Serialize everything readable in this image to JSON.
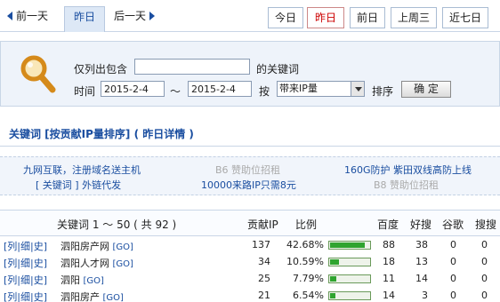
{
  "nav": {
    "prev_label": "前一天",
    "current_label": "昨日",
    "next_label": "后一天",
    "tabs": [
      {
        "label": "今日",
        "active": false
      },
      {
        "label": "昨日",
        "active": true
      },
      {
        "label": "前日",
        "active": false
      },
      {
        "label": "上周三",
        "active": false
      },
      {
        "label": "近七日",
        "active": false
      }
    ]
  },
  "filter": {
    "only_list_label": "仅列出包含",
    "keyword_value": "",
    "keyword_suffix": "的关键词",
    "time_label": "时间",
    "date_from": "2015-2-4",
    "range_sep": "～",
    "date_to": "2015-2-4",
    "by_label": "按",
    "sort_select": "带来IP量",
    "sort_label": "排序",
    "confirm_button": "确 定"
  },
  "section_title": "关键词 [按贡献IP量排序] ( 昨日详情 )",
  "ads": [
    {
      "text": "九网互联，注册域名送主机"
    },
    {
      "text": "B6 赞助位招租"
    },
    {
      "text": "160G防护 紫田双线高防上线"
    },
    {
      "text": "[ 关键词 ] 外链代发"
    },
    {
      "text": "10000来路IP只需8元"
    },
    {
      "text": "B8 赞助位招租"
    }
  ],
  "table": {
    "headers": {
      "keyword": "关键词 1 ～ 50 ( 共 92 )",
      "ip": "贡献IP",
      "ratio": "比例",
      "baidu": "百度",
      "haosou": "好搜",
      "google": "谷歌",
      "sougou": "搜搜"
    },
    "rows": [
      {
        "links": "[列|细|史]",
        "keyword": "泗阳房产网",
        "go": "[GO]",
        "ip": "137",
        "ratio": "42.68%",
        "ratio_value": 0.4268,
        "baidu": "88",
        "haosou": "38",
        "google": "0",
        "sougou": "0"
      },
      {
        "links": "[列|细|史]",
        "keyword": "泗阳人才网",
        "go": "[GO]",
        "ip": "34",
        "ratio": "10.59%",
        "ratio_value": 0.1059,
        "baidu": "18",
        "haosou": "13",
        "google": "0",
        "sougou": "0"
      },
      {
        "links": "[列|细|史]",
        "keyword": "泗阳",
        "go": "[GO]",
        "ip": "25",
        "ratio": "7.79%",
        "ratio_value": 0.0779,
        "baidu": "11",
        "haosou": "14",
        "google": "0",
        "sougou": "0"
      },
      {
        "links": "[列|细|史]",
        "keyword": "泗阳房产",
        "go": "[GO]",
        "ip": "21",
        "ratio": "6.54%",
        "ratio_value": 0.0654,
        "baidu": "14",
        "haosou": "3",
        "google": "0",
        "sougou": "0"
      }
    ]
  }
}
